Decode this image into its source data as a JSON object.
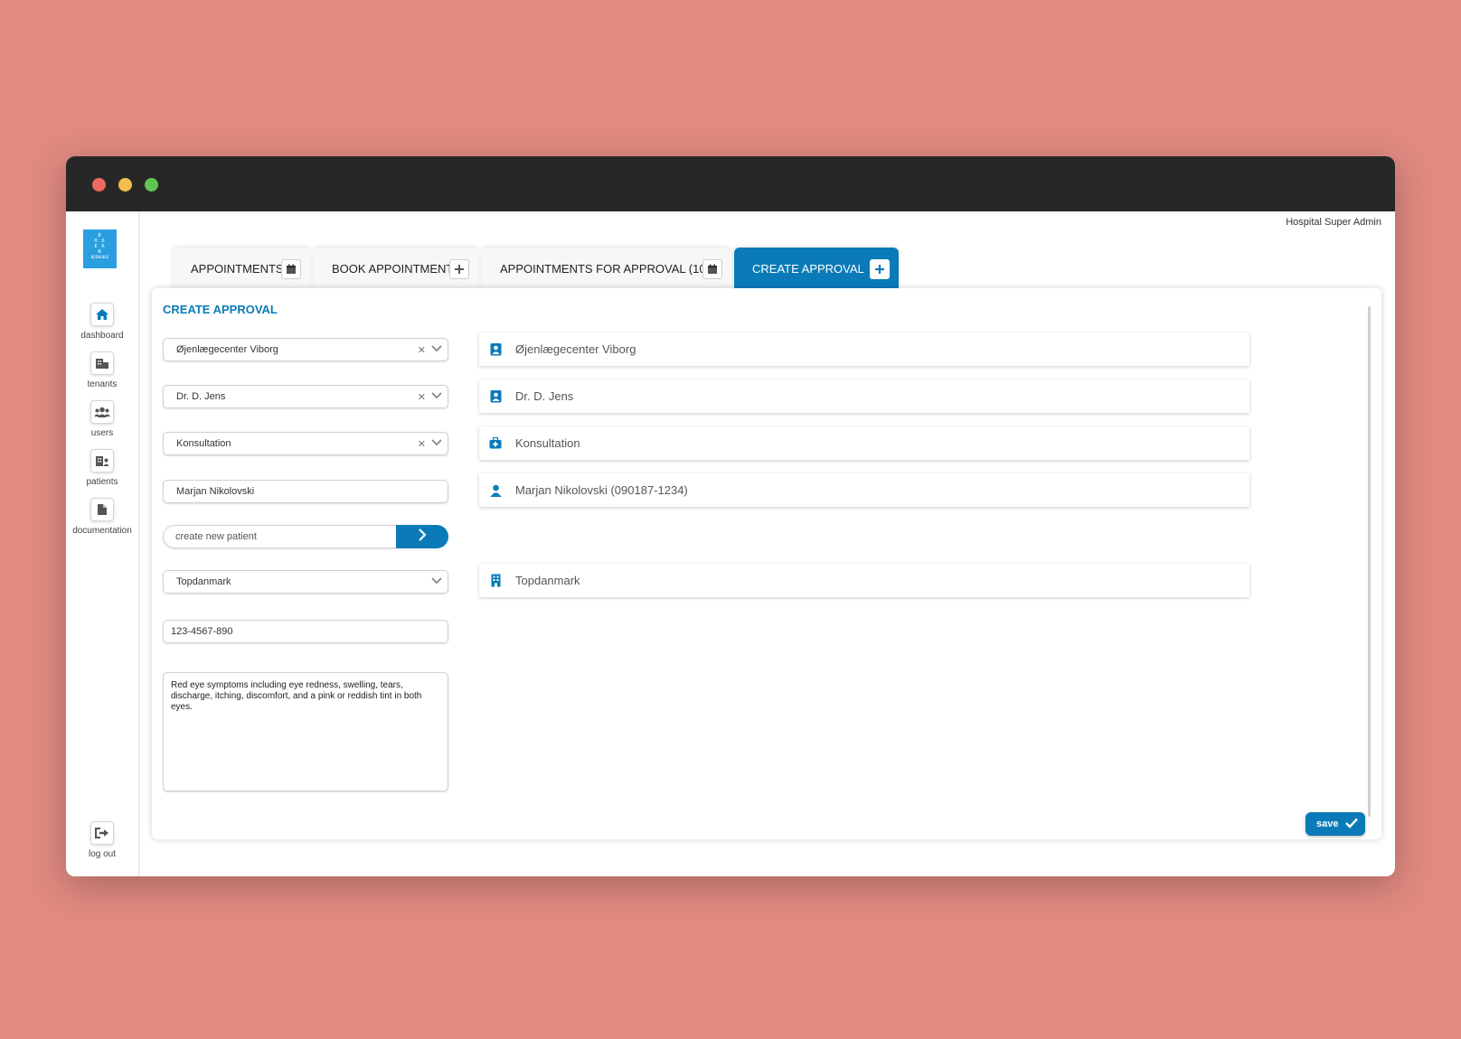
{
  "window": {
    "header": {
      "user_role": "Hospital Super Admin"
    },
    "logo_text": [
      "Ø",
      "H D",
      "E R",
      "N",
      "ØJENLÆGE"
    ]
  },
  "sidebar": {
    "items": [
      {
        "label": "dashboard",
        "icon": "home-icon"
      },
      {
        "label": "tenants",
        "icon": "building-icon"
      },
      {
        "label": "users",
        "icon": "users-icon"
      },
      {
        "label": "patients",
        "icon": "building-user-icon"
      },
      {
        "label": "documentation",
        "icon": "file-icon"
      }
    ],
    "logout": {
      "label": "log out",
      "icon": "sign-out-icon"
    }
  },
  "tabs": [
    {
      "label": "APPOINTMENTS",
      "icon": "calendar-icon"
    },
    {
      "label": "BOOK APPOINTMENT",
      "icon": "plus-icon"
    },
    {
      "label": "APPOINTMENTS FOR APPROVAL (10)",
      "icon": "calendar-icon"
    },
    {
      "label": "CREATE APPROVAL",
      "icon": "plus-icon",
      "active": true
    }
  ],
  "form": {
    "title": "CREATE APPROVAL",
    "clinic": "Øjenlægecenter Viborg",
    "doctor": "Dr. D. Jens",
    "service": "Konsultation",
    "patient": "Marjan Nikolovski",
    "create_patient_placeholder": "create new patient",
    "insurance": "Topdanmark",
    "phone": "123-4567-890",
    "notes": "Red eye symptoms including eye redness, swelling, tears, discharge, itching, discomfort, and a pink or reddish tint in both eyes.",
    "save_label": "save"
  },
  "summary": {
    "clinic": "Øjenlægecenter Viborg",
    "doctor": "Dr. D. Jens",
    "service": "Konsultation",
    "patient": "Marjan Nikolovski (090187-1234)",
    "insurance": "Topdanmark"
  },
  "colors": {
    "accent": "#0a7bb8",
    "background": "#e08a80",
    "titlebar": "#272727"
  }
}
